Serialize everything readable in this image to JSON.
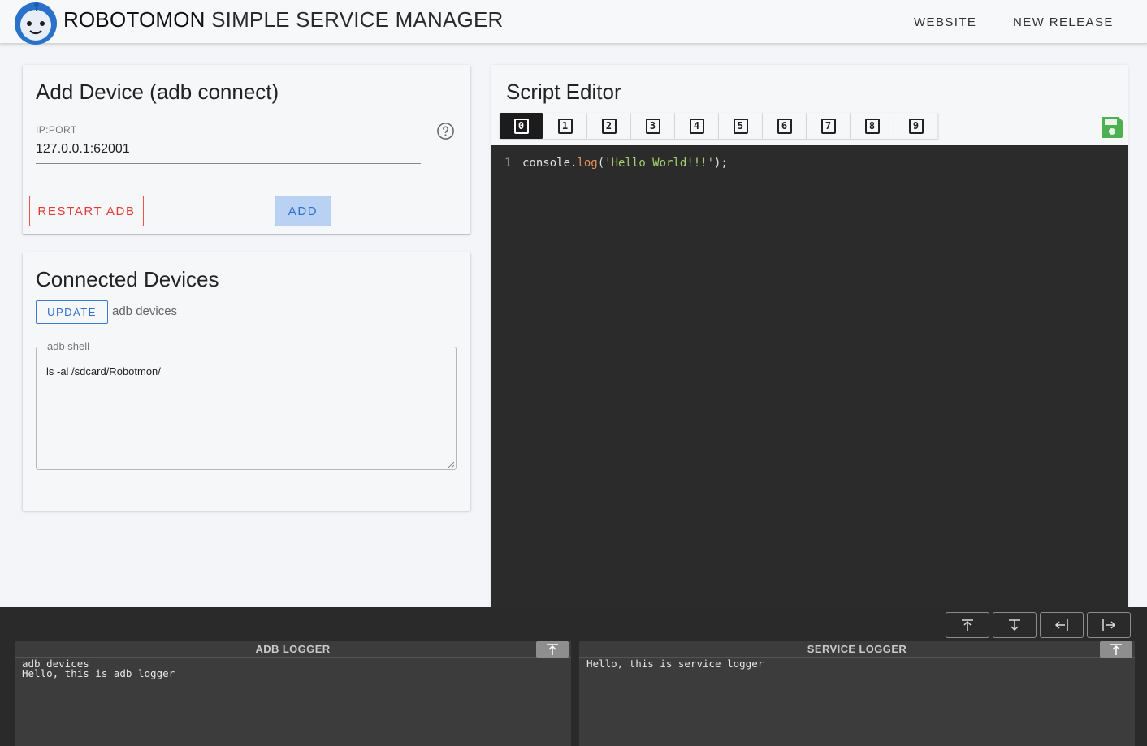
{
  "header": {
    "title_strong": "ROBOTOMON",
    "title_rest": "SIMPLE SERVICE MANAGER",
    "nav": {
      "website": "WEBSITE",
      "new_release": "NEW RELEASE"
    }
  },
  "add_device": {
    "title": "Add Device (adb connect)",
    "field_label": "IP:PORT",
    "field_value": "127.0.0.1:62001",
    "restart_label": "RESTART ADB",
    "add_label": "ADD"
  },
  "connected": {
    "title": "Connected Devices",
    "update_label": "UPDATE",
    "update_hint": "adb devices",
    "shell_legend": "adb shell",
    "shell_value": "ls -al /sdcard/Robotmon/"
  },
  "editor": {
    "title": "Script Editor",
    "tabs": [
      "0",
      "1",
      "2",
      "3",
      "4",
      "5",
      "6",
      "7",
      "8",
      "9"
    ],
    "active_tab": "0",
    "line_number": "1",
    "code": {
      "obj": "console.",
      "fn": "log",
      "open": "(",
      "str": "'Hello World!!!'",
      "close": ");"
    }
  },
  "loggers": {
    "adb": {
      "title": "ADB LOGGER",
      "lines": "adb devices\nHello, this is adb logger"
    },
    "service": {
      "title": "SERVICE LOGGER",
      "lines": "Hello, this is service logger"
    }
  },
  "colors": {
    "accent_blue": "#2f6fd1",
    "danger_red": "#e53935",
    "save_green": "#4caf50",
    "editor_bg": "#2b2b2b"
  },
  "icons": [
    "robot-logo",
    "help-circle-icon",
    "save-icon",
    "arrow-up-icon",
    "arrow-down-icon",
    "arrow-left-icon",
    "arrow-right-icon"
  ]
}
